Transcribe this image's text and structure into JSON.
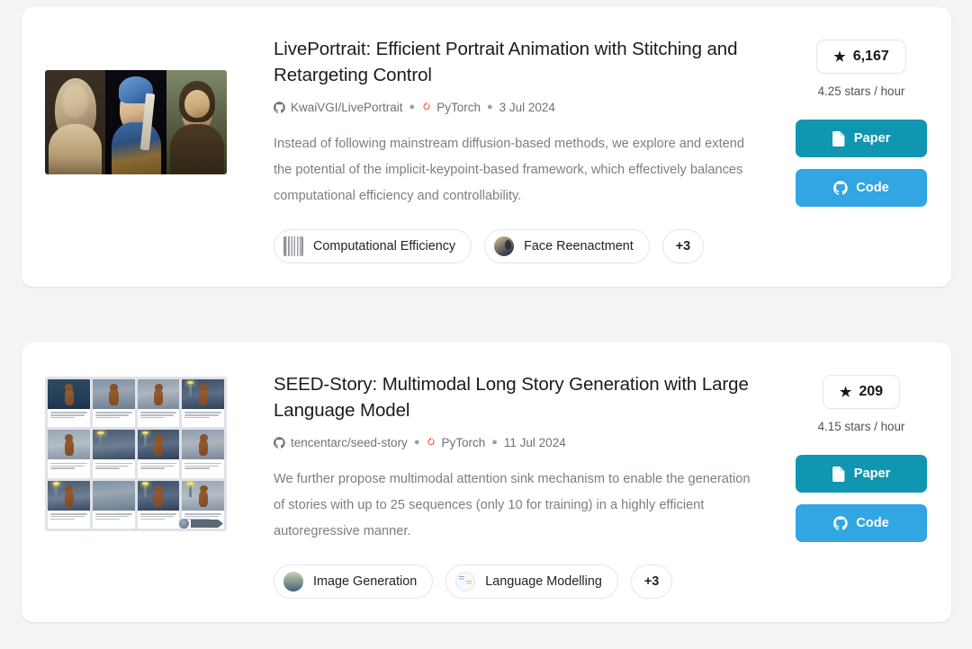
{
  "theme": {
    "page_background": "#f4f4f5",
    "card_background": "#ffffff",
    "paper_button_color": "#1096b0",
    "code_button_color": "#32a5e3",
    "title_color": "#1b1b1f",
    "body_text_color": "#7a7f86",
    "meta_text_color": "#6d7278",
    "pytorch_icon_color": "#ee4c2c"
  },
  "papers": [
    {
      "id": "liveportrait",
      "thumbnail": "three-classical-portrait-paintings",
      "title": "LivePortrait: Efficient Portrait Animation with Stitching and Retargeting Control",
      "repo": "KwaiVGI/LivePortrait",
      "framework": "PyTorch",
      "date": "3 Jul 2024",
      "abstract": "Instead of following mainstream diffusion-based methods, we explore and extend the potential of the implicit-keypoint-based framework, which effectively balances computational efficiency and controllability.",
      "tags": [
        {
          "label": "Computational Efficiency",
          "icon": "barcode-thumbnail"
        },
        {
          "label": "Face Reenactment",
          "icon": "face-photo-thumbnail"
        }
      ],
      "tags_overflow": "+3",
      "stars": "6,167",
      "star_icon": "star-icon",
      "rate": "4.25 stars / hour",
      "paper_button": "Paper",
      "paper_button_icon": "document-icon",
      "code_button": "Code",
      "code_button_icon": "github-icon"
    },
    {
      "id": "seed-story",
      "thumbnail": "comic-storyboard-grid",
      "title": "SEED-Story: Multimodal Long Story Generation with Large Language Model",
      "repo": "tencentarc/seed-story",
      "framework": "PyTorch",
      "date": "11 Jul 2024",
      "abstract": "We further propose multimodal attention sink mechanism to enable the generation of stories with up to 25 sequences (only 10 for training) in a highly efficient autoregressive manner.",
      "tags": [
        {
          "label": "Image Generation",
          "icon": "landscape-photo-thumbnail"
        },
        {
          "label": "Language Modelling",
          "icon": "document-chart-thumbnail"
        }
      ],
      "tags_overflow": "+3",
      "stars": "209",
      "star_icon": "star-icon",
      "rate": "4.15 stars / hour",
      "paper_button": "Paper",
      "paper_button_icon": "document-icon",
      "code_button": "Code",
      "code_button_icon": "github-icon"
    }
  ],
  "glyphs": {
    "star": "★",
    "bullet": "●"
  }
}
